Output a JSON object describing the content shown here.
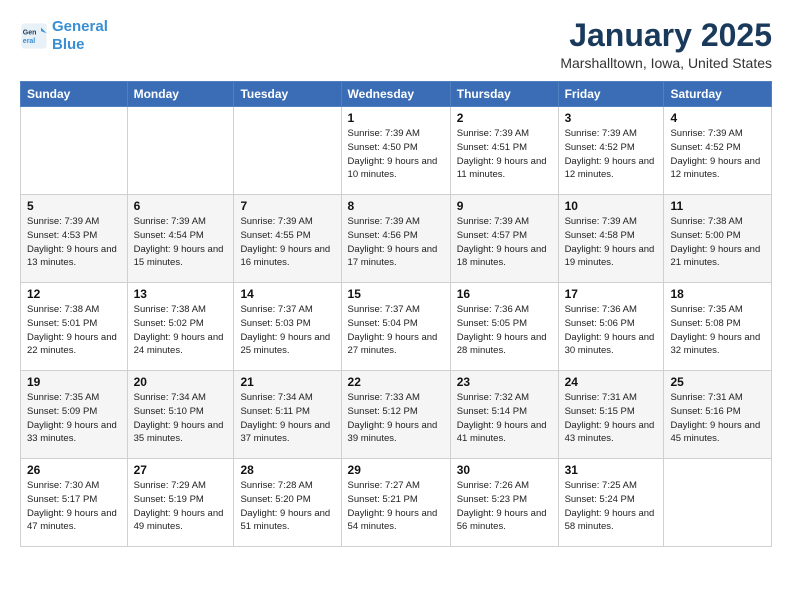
{
  "header": {
    "logo_line1": "General",
    "logo_line2": "Blue",
    "month": "January 2025",
    "location": "Marshalltown, Iowa, United States"
  },
  "weekdays": [
    "Sunday",
    "Monday",
    "Tuesday",
    "Wednesday",
    "Thursday",
    "Friday",
    "Saturday"
  ],
  "weeks": [
    [
      {
        "day": "",
        "info": ""
      },
      {
        "day": "",
        "info": ""
      },
      {
        "day": "",
        "info": ""
      },
      {
        "day": "1",
        "info": "Sunrise: 7:39 AM\nSunset: 4:50 PM\nDaylight: 9 hours\nand 10 minutes."
      },
      {
        "day": "2",
        "info": "Sunrise: 7:39 AM\nSunset: 4:51 PM\nDaylight: 9 hours\nand 11 minutes."
      },
      {
        "day": "3",
        "info": "Sunrise: 7:39 AM\nSunset: 4:52 PM\nDaylight: 9 hours\nand 12 minutes."
      },
      {
        "day": "4",
        "info": "Sunrise: 7:39 AM\nSunset: 4:52 PM\nDaylight: 9 hours\nand 12 minutes."
      }
    ],
    [
      {
        "day": "5",
        "info": "Sunrise: 7:39 AM\nSunset: 4:53 PM\nDaylight: 9 hours\nand 13 minutes."
      },
      {
        "day": "6",
        "info": "Sunrise: 7:39 AM\nSunset: 4:54 PM\nDaylight: 9 hours\nand 15 minutes."
      },
      {
        "day": "7",
        "info": "Sunrise: 7:39 AM\nSunset: 4:55 PM\nDaylight: 9 hours\nand 16 minutes."
      },
      {
        "day": "8",
        "info": "Sunrise: 7:39 AM\nSunset: 4:56 PM\nDaylight: 9 hours\nand 17 minutes."
      },
      {
        "day": "9",
        "info": "Sunrise: 7:39 AM\nSunset: 4:57 PM\nDaylight: 9 hours\nand 18 minutes."
      },
      {
        "day": "10",
        "info": "Sunrise: 7:39 AM\nSunset: 4:58 PM\nDaylight: 9 hours\nand 19 minutes."
      },
      {
        "day": "11",
        "info": "Sunrise: 7:38 AM\nSunset: 5:00 PM\nDaylight: 9 hours\nand 21 minutes."
      }
    ],
    [
      {
        "day": "12",
        "info": "Sunrise: 7:38 AM\nSunset: 5:01 PM\nDaylight: 9 hours\nand 22 minutes."
      },
      {
        "day": "13",
        "info": "Sunrise: 7:38 AM\nSunset: 5:02 PM\nDaylight: 9 hours\nand 24 minutes."
      },
      {
        "day": "14",
        "info": "Sunrise: 7:37 AM\nSunset: 5:03 PM\nDaylight: 9 hours\nand 25 minutes."
      },
      {
        "day": "15",
        "info": "Sunrise: 7:37 AM\nSunset: 5:04 PM\nDaylight: 9 hours\nand 27 minutes."
      },
      {
        "day": "16",
        "info": "Sunrise: 7:36 AM\nSunset: 5:05 PM\nDaylight: 9 hours\nand 28 minutes."
      },
      {
        "day": "17",
        "info": "Sunrise: 7:36 AM\nSunset: 5:06 PM\nDaylight: 9 hours\nand 30 minutes."
      },
      {
        "day": "18",
        "info": "Sunrise: 7:35 AM\nSunset: 5:08 PM\nDaylight: 9 hours\nand 32 minutes."
      }
    ],
    [
      {
        "day": "19",
        "info": "Sunrise: 7:35 AM\nSunset: 5:09 PM\nDaylight: 9 hours\nand 33 minutes."
      },
      {
        "day": "20",
        "info": "Sunrise: 7:34 AM\nSunset: 5:10 PM\nDaylight: 9 hours\nand 35 minutes."
      },
      {
        "day": "21",
        "info": "Sunrise: 7:34 AM\nSunset: 5:11 PM\nDaylight: 9 hours\nand 37 minutes."
      },
      {
        "day": "22",
        "info": "Sunrise: 7:33 AM\nSunset: 5:12 PM\nDaylight: 9 hours\nand 39 minutes."
      },
      {
        "day": "23",
        "info": "Sunrise: 7:32 AM\nSunset: 5:14 PM\nDaylight: 9 hours\nand 41 minutes."
      },
      {
        "day": "24",
        "info": "Sunrise: 7:31 AM\nSunset: 5:15 PM\nDaylight: 9 hours\nand 43 minutes."
      },
      {
        "day": "25",
        "info": "Sunrise: 7:31 AM\nSunset: 5:16 PM\nDaylight: 9 hours\nand 45 minutes."
      }
    ],
    [
      {
        "day": "26",
        "info": "Sunrise: 7:30 AM\nSunset: 5:17 PM\nDaylight: 9 hours\nand 47 minutes."
      },
      {
        "day": "27",
        "info": "Sunrise: 7:29 AM\nSunset: 5:19 PM\nDaylight: 9 hours\nand 49 minutes."
      },
      {
        "day": "28",
        "info": "Sunrise: 7:28 AM\nSunset: 5:20 PM\nDaylight: 9 hours\nand 51 minutes."
      },
      {
        "day": "29",
        "info": "Sunrise: 7:27 AM\nSunset: 5:21 PM\nDaylight: 9 hours\nand 54 minutes."
      },
      {
        "day": "30",
        "info": "Sunrise: 7:26 AM\nSunset: 5:23 PM\nDaylight: 9 hours\nand 56 minutes."
      },
      {
        "day": "31",
        "info": "Sunrise: 7:25 AM\nSunset: 5:24 PM\nDaylight: 9 hours\nand 58 minutes."
      },
      {
        "day": "",
        "info": ""
      }
    ]
  ]
}
